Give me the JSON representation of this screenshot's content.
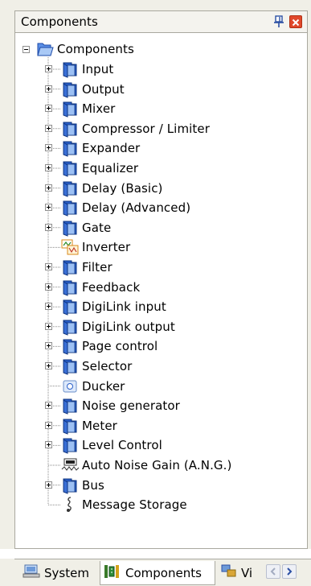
{
  "panel": {
    "title": "Components"
  },
  "tree": {
    "root_label": "Components",
    "items": [
      {
        "label": "Input",
        "icon": "folder-icon",
        "expandable": true
      },
      {
        "label": "Output",
        "icon": "folder-icon",
        "expandable": true
      },
      {
        "label": "Mixer",
        "icon": "folder-icon",
        "expandable": true
      },
      {
        "label": "Compressor / Limiter",
        "icon": "folder-icon",
        "expandable": true
      },
      {
        "label": "Expander",
        "icon": "folder-icon",
        "expandable": true
      },
      {
        "label": "Equalizer",
        "icon": "folder-icon",
        "expandable": true
      },
      {
        "label": "Delay (Basic)",
        "icon": "folder-icon",
        "expandable": true
      },
      {
        "label": "Delay (Advanced)",
        "icon": "folder-icon",
        "expandable": true
      },
      {
        "label": "Gate",
        "icon": "folder-icon",
        "expandable": true
      },
      {
        "label": "Inverter",
        "icon": "inverter-icon",
        "expandable": false
      },
      {
        "label": "Filter",
        "icon": "folder-icon",
        "expandable": true
      },
      {
        "label": "Feedback",
        "icon": "folder-icon",
        "expandable": true
      },
      {
        "label": "DigiLink input",
        "icon": "folder-icon",
        "expandable": true
      },
      {
        "label": "DigiLink output",
        "icon": "folder-icon",
        "expandable": true
      },
      {
        "label": "Page control",
        "icon": "folder-icon",
        "expandable": true
      },
      {
        "label": "Selector",
        "icon": "folder-icon",
        "expandable": true
      },
      {
        "label": "Ducker",
        "icon": "ducker-icon",
        "expandable": false
      },
      {
        "label": "Noise generator",
        "icon": "folder-icon",
        "expandable": true
      },
      {
        "label": "Meter",
        "icon": "folder-icon",
        "expandable": true
      },
      {
        "label": "Level Control",
        "icon": "folder-icon",
        "expandable": true
      },
      {
        "label": "Auto Noise Gain (A.N.G.)",
        "icon": "ang-icon",
        "expandable": false
      },
      {
        "label": "Bus",
        "icon": "folder-icon",
        "expandable": true
      },
      {
        "label": "Message Storage",
        "icon": "message-storage-icon",
        "expandable": false
      }
    ]
  },
  "tabs": [
    {
      "label": "System",
      "icon": "system-icon",
      "active": false
    },
    {
      "label": "Components",
      "icon": "components-icon",
      "active": true
    },
    {
      "label": "Vi",
      "icon": "view-icon",
      "active": false
    }
  ],
  "colors": {
    "folder_blue": "#2a5fc9",
    "folder_light": "#9cc0f4",
    "close_red": "#e0482b",
    "panel_bg": "#f0efe7"
  }
}
